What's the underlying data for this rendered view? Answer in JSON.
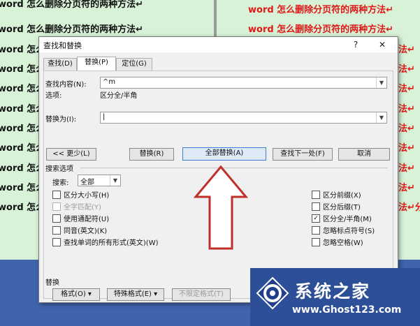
{
  "document": {
    "line_text": "word 怎么删除分页符的两种方法",
    "left_lines": [
      "word 怎么删除分页符的两种方法↵",
      "word 怎么删除分页符的两种方法↵",
      "word 怎么删除分页符的两种方法↵",
      "word 怎么删除分页符的两种方法↵",
      "word 怎么删除分页符的两种方法↵",
      "word 怎么删除分页符的两种方法↵",
      "word 怎么删除分页符的两种方法↵",
      "word 怎么删除分页符的两种方法↵",
      "word 怎么删除分页符的两种方法↵",
      "word 怎么删除分页符的两种方法↵",
      "word 怎么删除分页符的两种方法↵"
    ],
    "right_lines": [
      "word 怎么删除分页符的两种方法↵",
      "word 怎么删除分页符的两种方法↵",
      "法↵",
      "法↵",
      "法↵",
      "法↵",
      "法↵",
      "法↵",
      "法↵",
      "法↵",
      "法↵分"
    ]
  },
  "dialog": {
    "title": "查找和替换",
    "help": "?",
    "close": "✕",
    "tabs": [
      "查找(D)",
      "替换(P)",
      "定位(G)"
    ],
    "find_label": "查找内容(N):",
    "find_value": "^m",
    "options_label": "选项:",
    "options_value": "区分全/半角",
    "replace_label": "替换为(I):",
    "replace_value": "",
    "less_button": "<< 更少(L)",
    "replace_button": "替换(R)",
    "replace_all_button": "全部替换(A)",
    "find_next_button": "查找下一处(F)",
    "cancel_button": "取消",
    "search_options_title": "搜索选项",
    "search_label": "搜索:",
    "search_value": "全部",
    "left_checks": [
      {
        "label": "区分大小写(H)",
        "checked": false,
        "disabled": false
      },
      {
        "label": "全字匹配(Y)",
        "checked": false,
        "disabled": true
      },
      {
        "label": "使用通配符(U)",
        "checked": false,
        "disabled": false
      },
      {
        "label": "同音(英文)(K)",
        "checked": false,
        "disabled": false
      },
      {
        "label": "查找单词的所有形式(英文)(W)",
        "checked": false,
        "disabled": false
      }
    ],
    "right_checks": [
      {
        "label": "区分前缀(X)",
        "checked": false
      },
      {
        "label": "区分后缀(T)",
        "checked": false
      },
      {
        "label": "区分全/半角(M)",
        "checked": true
      },
      {
        "label": "忽略标点符号(S)",
        "checked": false
      },
      {
        "label": "忽略空格(W)",
        "checked": false
      }
    ],
    "replace_section_title": "替换",
    "format_button": "格式(O) ▾",
    "special_button": "特殊格式(E) ▾",
    "no_format_button": "不限定格式(T)"
  },
  "watermark": {
    "brand": "系统之家",
    "url": "www.Ghost123.com"
  },
  "colors": {
    "doc_bg": "#d7f2d7",
    "red_text": "#e01818",
    "arrow": "#c0302a",
    "desktop": "#3b5fa8"
  }
}
